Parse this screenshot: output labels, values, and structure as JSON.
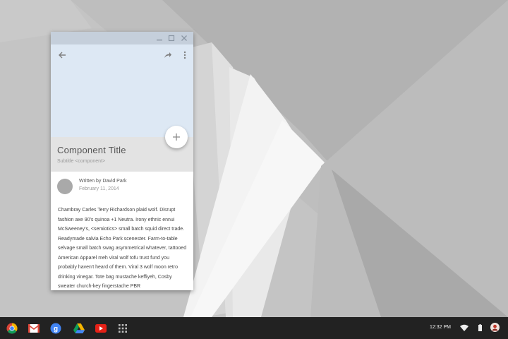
{
  "window": {
    "card": {
      "title": "Component Title",
      "subtitle": "Subtitle <component>",
      "author_line": "Written by David Park",
      "date": "February 11, 2014",
      "body": "Chambray Carles Terry Richardson plaid wolf. Disrupt fashion axe 90's quinoa +1 Neutra. Irony ethnic ennui McSweeney's, <semiotics> small batch squid direct trade. Readymade salvia Echo Park scenester. Farm-to-table selvage small batch swag asymmetrical whatever, tattooed American Apparel meh viral wolf tofu trust fund you probably haven't heard of them. Viral 3 wolf moon retro drinking  vinegar. Tote bag mustache keffiyeh, Cosby sweater church-key fingerstache PBR"
    },
    "icons": {
      "minimize": "minimize-icon",
      "maximize": "maximize-icon",
      "close": "close-icon",
      "back": "arrow-back-icon",
      "share": "share-icon",
      "more": "more-vert-icon",
      "fab": "plus-icon"
    },
    "colors": {
      "titlebar": "#c5cfdb",
      "hero": "#dde8f4",
      "title_band": "#e3e3e3"
    }
  },
  "shelf": {
    "apps": [
      {
        "name": "Chrome",
        "icon": "chrome-icon"
      },
      {
        "name": "Gmail",
        "icon": "gmail-icon"
      },
      {
        "name": "Google+",
        "icon": "google-plus-icon"
      },
      {
        "name": "Drive",
        "icon": "drive-icon"
      },
      {
        "name": "YouTube",
        "icon": "youtube-icon"
      },
      {
        "name": "App launcher",
        "icon": "app-launcher-icon"
      }
    ],
    "clock": "12:32 PM",
    "tray": {
      "wifi": "wifi-icon",
      "battery": "battery-icon",
      "avatar": "user-avatar"
    }
  }
}
